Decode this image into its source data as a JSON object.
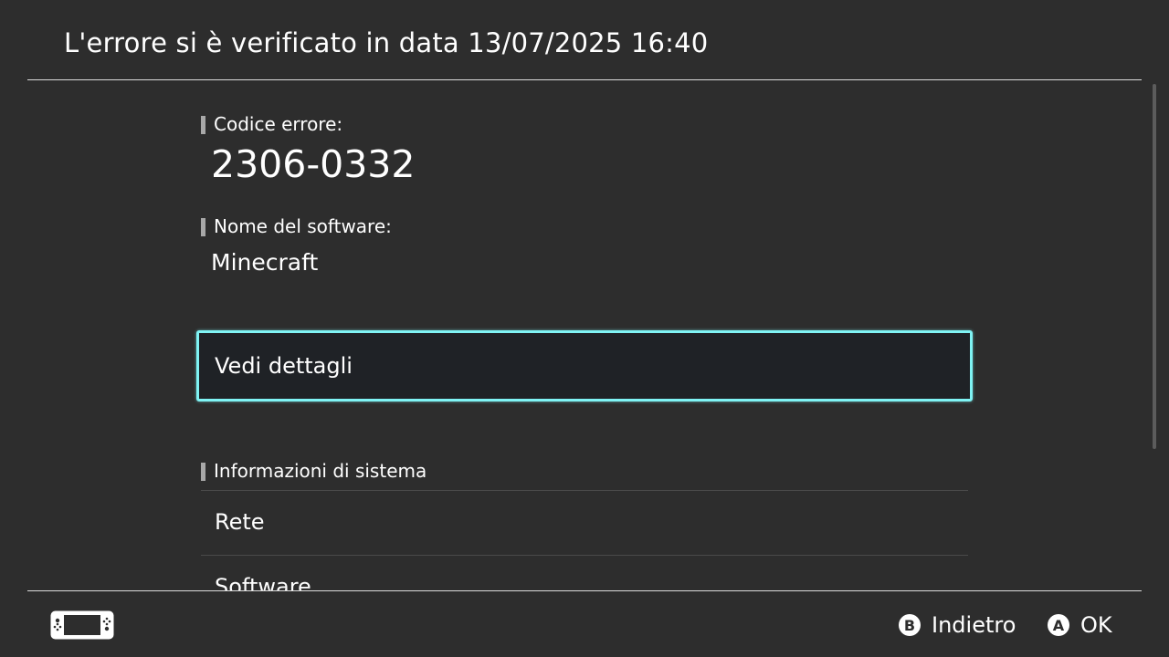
{
  "header": {
    "title": "L'errore si è verificato in data 13/07/2025 16:40"
  },
  "error": {
    "code_label": "Codice errore:",
    "code": "2306-0332"
  },
  "software": {
    "name_label": "Nome del software:",
    "name": "Minecraft"
  },
  "details_button": {
    "label": "Vedi dettagli"
  },
  "system_info": {
    "label": "Informazioni di sistema",
    "items": [
      {
        "label": "Rete"
      },
      {
        "label": "Software"
      }
    ]
  },
  "footer": {
    "console_icon": "handheld-console-icon",
    "back": {
      "button_glyph": "B",
      "label": "Indietro"
    },
    "ok": {
      "button_glyph": "A",
      "label": "OK"
    }
  },
  "colors": {
    "background": "#2d2d2d",
    "focus_border": "#7ff3f4",
    "button_fill": "#1f2226",
    "divider": "#dcdcdc"
  }
}
